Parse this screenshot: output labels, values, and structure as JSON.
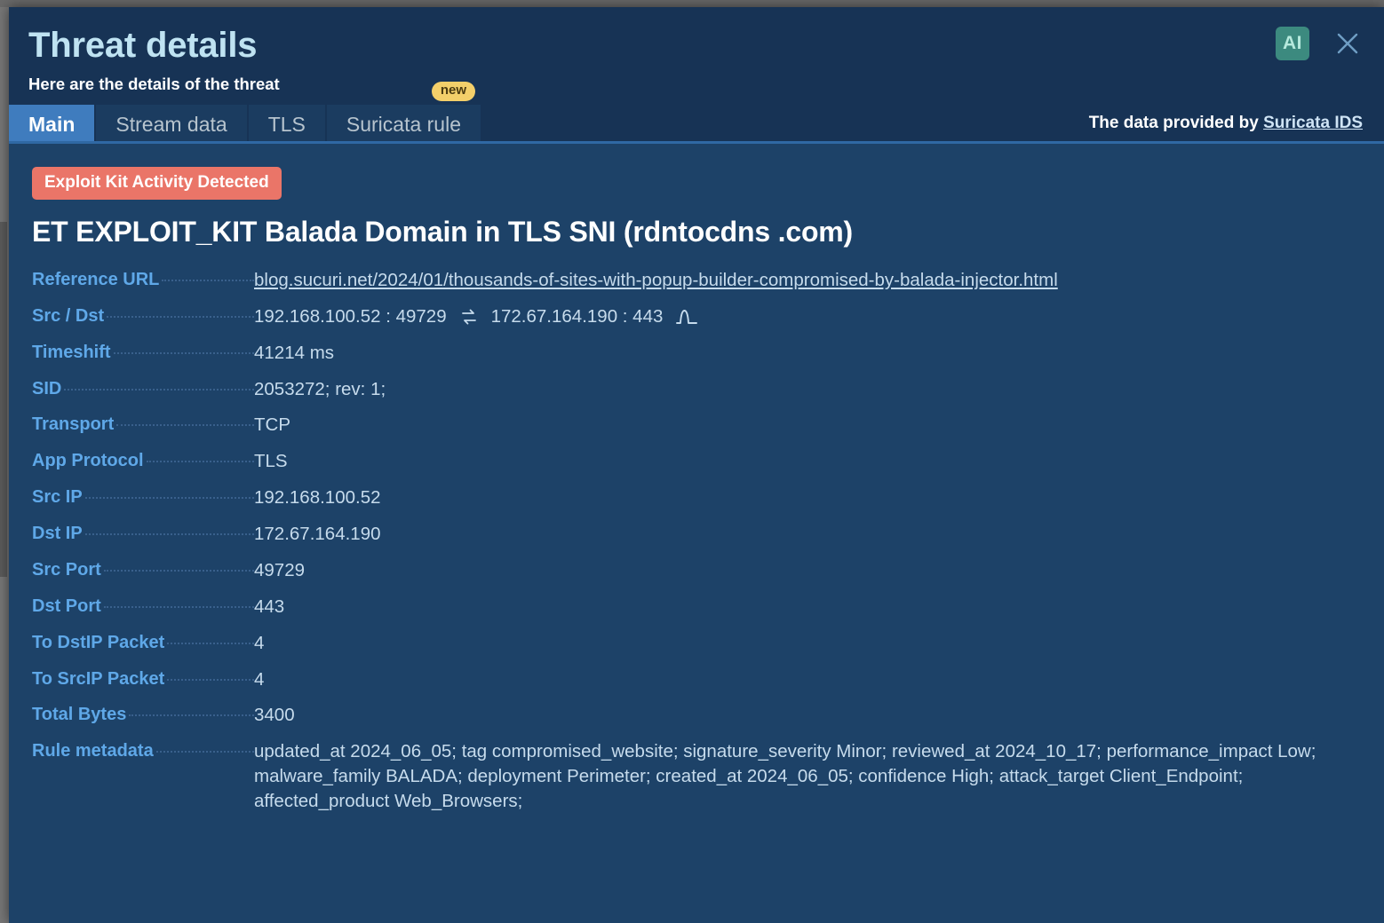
{
  "modal": {
    "title": "Threat details",
    "subtitle": "Here are the details of the threat",
    "ai_badge_label": "AI",
    "close_icon": "close-icon"
  },
  "tabs": [
    {
      "label": "Main",
      "active": true,
      "badge": null
    },
    {
      "label": "Stream data",
      "active": false,
      "badge": null
    },
    {
      "label": "TLS",
      "active": false,
      "badge": null
    },
    {
      "label": "Suricata rule",
      "active": false,
      "badge": "new"
    }
  ],
  "provider": {
    "prefix": "The data provided by ",
    "link_label": "Suricata IDS"
  },
  "alert": {
    "chip_label": "Exploit Kit Activity Detected",
    "threat_name": "ET EXPLOIT_KIT Balada Domain in TLS SNI (rdntocdns .com)",
    "chip_color": "#ea7568"
  },
  "details": {
    "reference_url_label": "Reference URL",
    "reference_url_value": "blog.sucuri.net/2024/01/thousands-of-sites-with-popup-builder-compromised-by-balada-injector.html",
    "src_dst_label": "Src / Dst",
    "src_dst_src": "192.168.100.52 : 49729",
    "src_dst_dst": "172.67.164.190 : 443",
    "timeshift_label": "Timeshift",
    "timeshift_value": "41214 ms",
    "sid_label": "SID",
    "sid_value": "2053272; rev: 1;",
    "transport_label": "Transport",
    "transport_value": "TCP",
    "app_protocol_label": "App Protocol",
    "app_protocol_value": "TLS",
    "src_ip_label": "Src IP",
    "src_ip_value": "192.168.100.52",
    "dst_ip_label": "Dst IP",
    "dst_ip_value": "172.67.164.190",
    "src_port_label": "Src Port",
    "src_port_value": "49729",
    "dst_port_label": "Dst Port",
    "dst_port_value": "443",
    "to_dstip_packet_label": "To DstIP Packet",
    "to_dstip_packet_value": "4",
    "to_srcip_packet_label": "To SrcIP Packet",
    "to_srcip_packet_value": "4",
    "total_bytes_label": "Total Bytes",
    "total_bytes_value": "3400",
    "rule_metadata_label": "Rule metadata",
    "rule_metadata_value": "updated_at 2024_06_05; tag compromised_website; signature_severity Minor; reviewed_at 2024_10_17; performance_impact Low; malware_family BALADA; deployment Perimeter; created_at 2024_06_05; confidence High; attack_target Client_Endpoint; affected_product Web_Browsers;"
  },
  "colors": {
    "header_bg": "#173355",
    "body_bg": "#1d4268",
    "active_tab": "#3f7cbe",
    "label_blue": "#5fa8e8",
    "value_text": "#c6dbec",
    "title_text": "#bfe3f2",
    "ai_badge_bg": "#3c8a7f",
    "new_badge_bg": "#f3cf6a"
  }
}
